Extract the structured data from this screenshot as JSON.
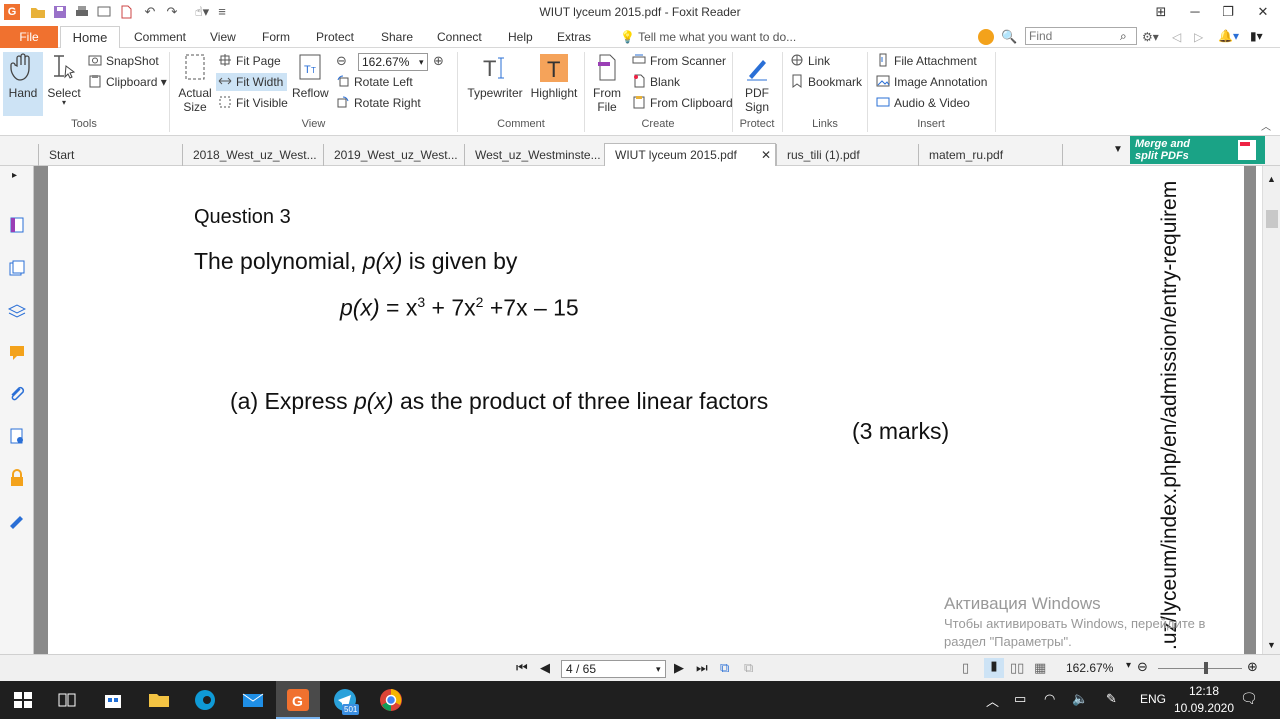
{
  "window": {
    "title": "WIUT lyceum 2015.pdf - Foxit Reader"
  },
  "ribbon_tabs": [
    "File",
    "Home",
    "Comment",
    "View",
    "Form",
    "Protect",
    "Share",
    "Connect",
    "Help",
    "Extras"
  ],
  "tell_me": "Tell me what you want to do...",
  "find_placeholder": "Find",
  "ribbon": {
    "tools": {
      "hand": "Hand",
      "select": "Select",
      "snapshot": "SnapShot",
      "clipboard": "Clipboard",
      "label": "Tools"
    },
    "view": {
      "actual_size_1": "Actual",
      "actual_size_2": "Size",
      "fit_page": "Fit Page",
      "fit_width": "Fit Width",
      "fit_visible": "Fit Visible",
      "reflow": "Reflow",
      "zoom": "162.67%",
      "rotate_left": "Rotate Left",
      "rotate_right": "Rotate Right",
      "label": "View"
    },
    "comment": {
      "typewriter": "Typewriter",
      "highlight": "Highlight",
      "label": "Comment"
    },
    "create": {
      "from_file_1": "From",
      "from_file_2": "File",
      "from_scanner": "From Scanner",
      "blank": "Blank",
      "from_clipboard": "From Clipboard",
      "label": "Create"
    },
    "protect": {
      "pdf_sign_1": "PDF",
      "pdf_sign_2": "Sign",
      "label": "Protect"
    },
    "links": {
      "link": "Link",
      "bookmark": "Bookmark",
      "label": "Links"
    },
    "insert": {
      "file_attachment": "File Attachment",
      "image_annotation": "Image Annotation",
      "audio_video": "Audio & Video",
      "label": "Insert"
    }
  },
  "doc_tabs": [
    "Start",
    "2018_West_uz_West...",
    "2019_West_uz_West...",
    "West_uz_Westminste...",
    "WIUT lyceum 2015.pdf",
    "rus_tili (1).pdf",
    "matem_ru.pdf"
  ],
  "merge_banner": {
    "line1": "Merge and",
    "line2": "split PDFs"
  },
  "document": {
    "heading": "Question 3",
    "intro_a": "The polynomial, ",
    "intro_var": "p(x)",
    "intro_b": " is given by",
    "eq_lhs": "p(x)",
    "eq_a": " = x",
    "eq_sup1": "3",
    "eq_b": " + 7x",
    "eq_sup2": "2",
    "eq_c": " +7x – 15",
    "part_a_1": "(a) Express ",
    "part_a_var": "p(x)",
    "part_a_2": " as the product of three linear factors",
    "marks": "(3 marks)",
    "side_url": ".uz/lyceum/index.php/en/admission/entry-requirem"
  },
  "watermark": {
    "line1": "Активация Windows",
    "line2": "Чтобы активировать Windows, перейдите в",
    "line3": "раздел \"Параметры\"."
  },
  "statusbar": {
    "page": "4 / 65",
    "zoom": "162.67%"
  },
  "taskbar": {
    "lang": "ENG",
    "time": "12:18",
    "date": "10.09.2020",
    "telegram_badge": "501"
  },
  "colors": {
    "accent": "#f0712f",
    "merge": "#1aa386",
    "taskbar": "#1f1f1f"
  }
}
